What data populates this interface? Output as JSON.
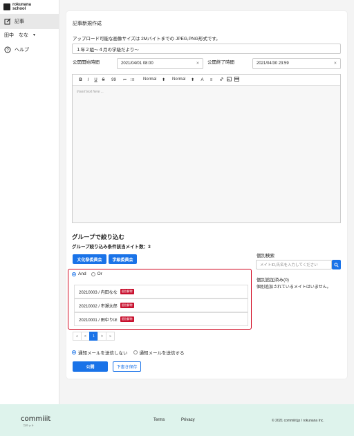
{
  "sidebar": {
    "logo_line1": "rokunana",
    "logo_line2": "school",
    "items": [
      {
        "label": "記事",
        "icon": "edit-icon"
      },
      {
        "label": "田中　なな",
        "icon": "user-dropdown"
      },
      {
        "label": "ヘルプ",
        "icon": "help-icon"
      }
    ]
  },
  "form": {
    "heading": "記事新規作成",
    "image_note": "アップロード可能な画像サイズは 2Mバイトまでの JPEG,PNG形式です。",
    "title_value": "１年２組〜４月の学級だより〜",
    "start_label": "公開開始時間",
    "start_value": "2021/04/01 08:00",
    "end_label": "公開終了時間",
    "end_value": "2021/04/30 23:59",
    "editor": {
      "toolbar": [
        "B",
        "I",
        "U",
        "S",
        "99",
        "≔",
        "⁝≡",
        "Normal",
        "Normal",
        "A",
        "≡",
        "🔗",
        "▣",
        "▤"
      ],
      "format1": "Normal",
      "format2": "Normal",
      "placeholder": "Insert text here ..."
    }
  },
  "group": {
    "title": "グループで絞り込む",
    "count_text": "グループ絞り込み条件該当メイト数：3",
    "buttons": [
      "文化祭委員会",
      "学級委員会"
    ],
    "and_label": "And",
    "or_label": "Or",
    "members": [
      {
        "name": "20210003 / 内田なな",
        "badge": "個別解除"
      },
      {
        "name": "20210002 / 市瀬太郎",
        "badge": "個別解除"
      },
      {
        "name": "20210001 / 田中りほ",
        "badge": "個別解除"
      }
    ],
    "pager": [
      "«",
      "<",
      "1",
      ">",
      "»"
    ]
  },
  "search": {
    "label": "個別検索",
    "placeholder": "メイトID,氏名を入力してください",
    "added_label": "個別追加済み(0)",
    "added_empty": "個別追加されているメイトはいません。"
  },
  "notify": {
    "no_send": "通知メールを送信しない",
    "send": "通知メールを送信する"
  },
  "actions": {
    "publish": "公開",
    "draft": "下書き保存"
  },
  "footer": {
    "logo": "commiiit",
    "logo_sub": "コミット",
    "terms": "Terms",
    "privacy": "Privacy",
    "copyright": "© 2021 commiiit.jp / rokunana Inc."
  },
  "colors": {
    "accent": "#1a73e8",
    "highlight_border": "#d0021b",
    "badge": "#c8102e",
    "footer_bg": "#def3ec"
  }
}
